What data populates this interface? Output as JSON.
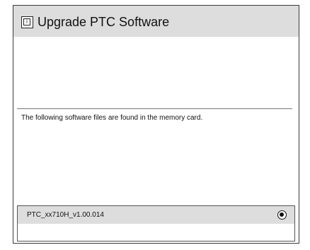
{
  "dialog": {
    "title": "Upgrade PTC Software",
    "title_icon": "info-icon",
    "title_icon_glyph": "i",
    "message": "The following software files are found in the memory card."
  },
  "files": [
    {
      "name": "PTC_xx710H_v1.00.014",
      "selected": true
    }
  ]
}
